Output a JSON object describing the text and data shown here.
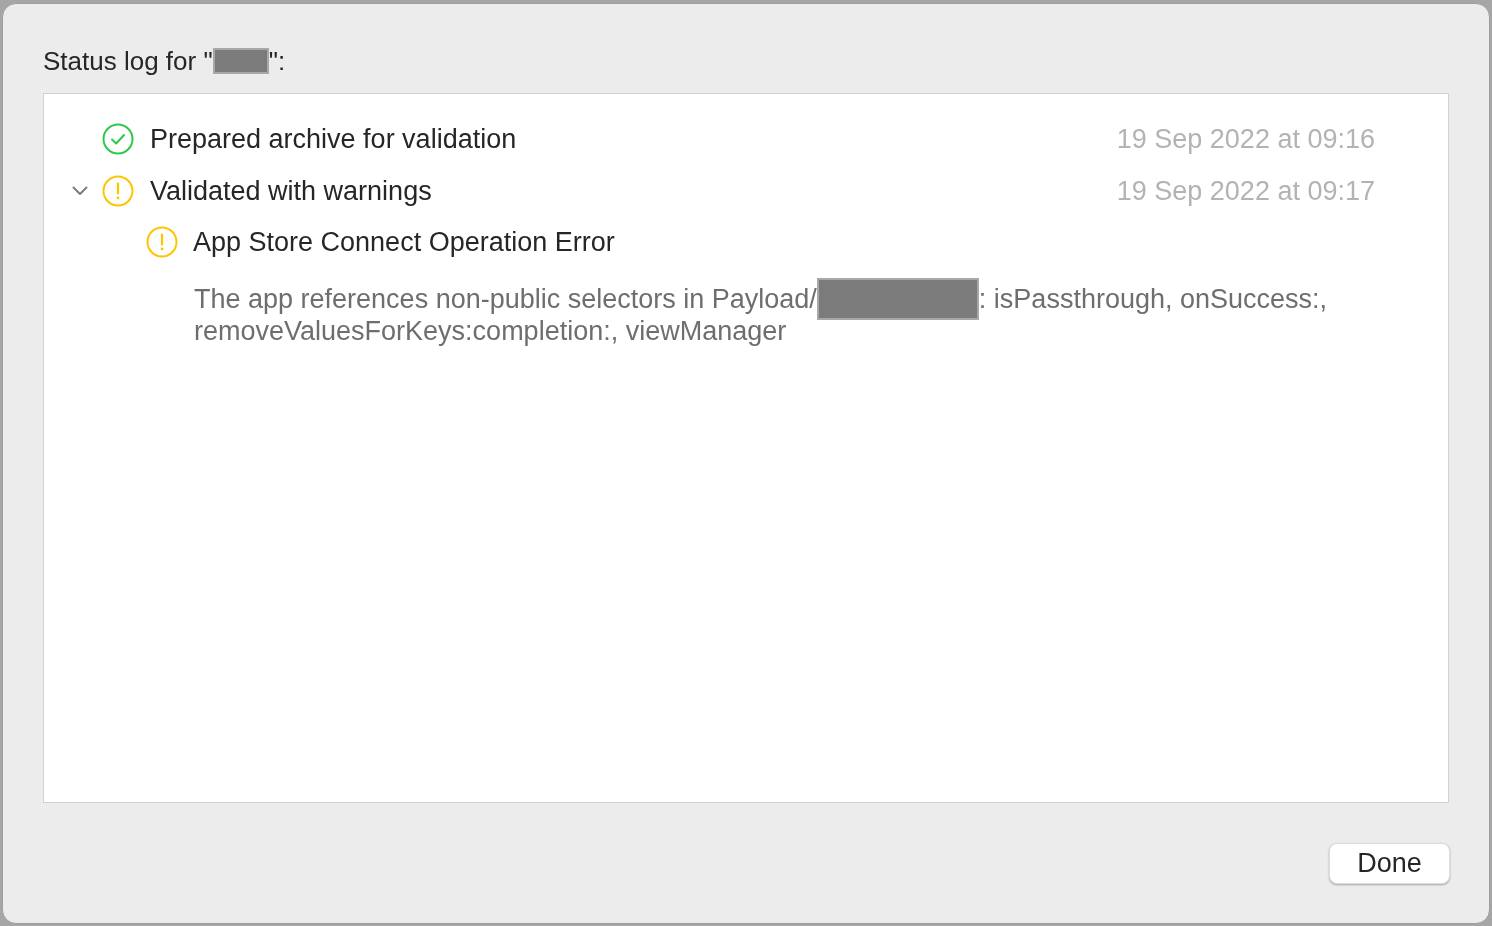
{
  "dialog": {
    "title": {
      "prefix": "Status log for \"",
      "redacted": true,
      "suffix": "\":"
    }
  },
  "log": {
    "entries": [
      {
        "kind": "success",
        "text": "Prepared archive for validation",
        "time": "19 Sep 2022 at 09:16"
      },
      {
        "kind": "warning",
        "text": "Validated with warnings",
        "time": "19 Sep 2022 at 09:17",
        "expanded": true,
        "children": [
          {
            "kind": "warning",
            "text": "App Store Connect Operation Error",
            "detail": {
              "before": "The app references non-public selectors in Payload/",
              "redacted": true,
              "after": ": isPassthrough, onSuccess:,",
              "continuation": "removeValuesForKeys:completion:, viewManager"
            }
          }
        ]
      }
    ]
  },
  "buttons": [
    {
      "label": "Done"
    }
  ]
}
